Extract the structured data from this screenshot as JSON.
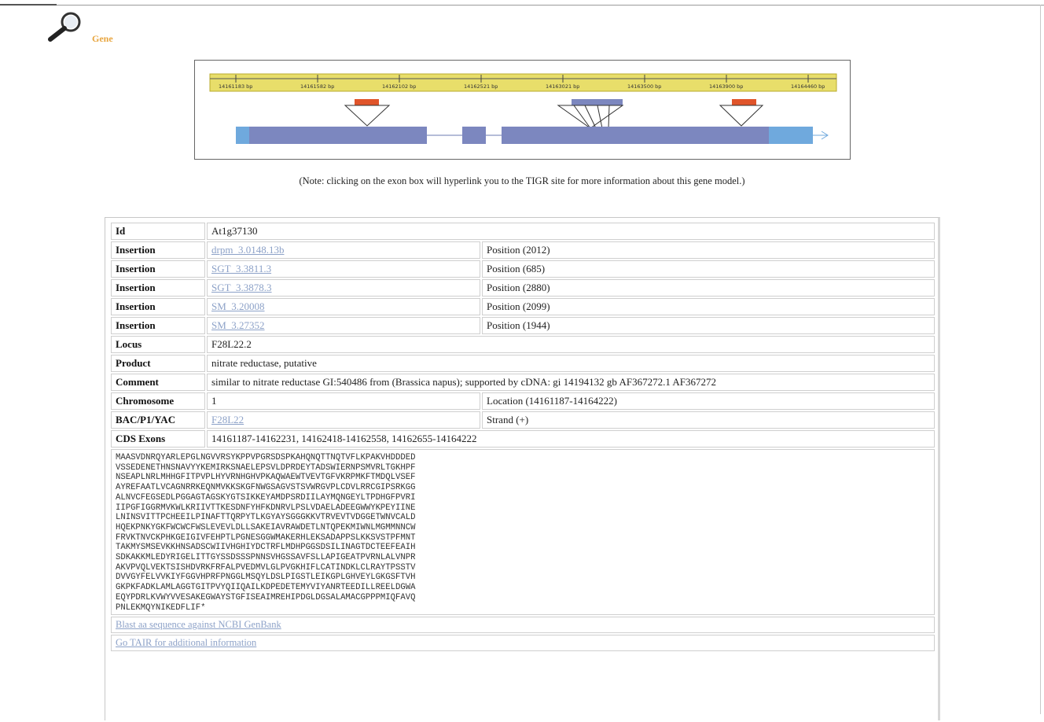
{
  "page": {
    "title": "Gene",
    "accent": "#e8a640"
  },
  "gene_model": {
    "ruler_labels": [
      "14161183 bp",
      "14161582 bp",
      "14162102 bp",
      "14162521 bp",
      "14163021 bp",
      "14163500 bp",
      "14163900 bp",
      "14164460 bp"
    ],
    "track_color": "#e8de6a",
    "exon_color": "#7c87bf",
    "utr_color": "#6fa9dd",
    "insertion_color": "#e0542a"
  },
  "note": "(Note: clicking on the exon box will hyperlink you to the TIGR site for more information about this gene model.)",
  "info": {
    "id_label": "Id",
    "id_value": "At1g37130",
    "insertions": [
      {
        "label": "Insertion",
        "link": "drpm_3.0148.13b",
        "position": "Position (2012)"
      },
      {
        "label": "Insertion",
        "link": "SGT_3.3811.3",
        "position": "Position (685)"
      },
      {
        "label": "Insertion",
        "link": "SGT_3.3878.3",
        "position": "Position (2880)"
      },
      {
        "label": "Insertion",
        "link": "SM_3.20008",
        "position": "Position (2099)"
      },
      {
        "label": "Insertion",
        "link": "SM_3.27352",
        "position": "Position (1944)"
      }
    ],
    "locus_label": "Locus",
    "locus_value": "F28L22.2",
    "product_label": "Product",
    "product_value": "nitrate reductase, putative",
    "comment_label": "Comment",
    "comment_value": "similar to nitrate reductase GI:540486 from (Brassica napus); supported by cDNA: gi 14194132 gb AF367272.1 AF367272",
    "chromosome_label": "Chromosome",
    "chromosome_value": "1",
    "location": "Location (14161187-14164222)",
    "bac_label": "BAC/P1/YAC",
    "bac_link": "F28L22",
    "strand": "Strand (+)",
    "cds_label": "CDS Exons",
    "cds_value": "14161187-14162231, 14162418-14162558, 14162655-14164222",
    "sequence": "MAASVDNRQYARLEPGLNGVVRSYKPPVPGRSDSPKAHQNQTTNQTVFLKPAKVHDDDED\nVSSEDENETHNSNAVYYKEMIRKSNAELEPSVLDPRDEYTADSWIERNPSMVRLTGKHPF\nNSEAPLNRLMHHGFITPVPLHYVRNHGHVPKAQWAEWTVEVTGFVKRPMKFTMDQLVSEF\nAYREFAATLVCAGNRRKEQNMVKKSKGFNWGSAGVSTSVWRGVPLCDVLRRCGIPSRKGG\nALNVCFEGSEDLPGGAGTAGSKYGTSIKKEYAMDPSRDIILAYMQNGEYLTPDHGFPVRI\nIIPGFIGGRMVKWLKRIIVTTKESDNFYHFKDNRVLPSLVDAELADEEGWWYKPEYIINE\nLNINSVITTPCHEEILPINAFTTQRPYTLKGYAYSGGGKKVTRVEVTVDGGETWNVCALD\nHQEKPNKYGKFWCWCFWSLEVEVLDLLSAKEIAVRAWDETLNTQPEKMIWNLMGMMNNCW\nFRVKTNVCKPHKGEIGIVFEHPTLPGNESGGWMAKERHLEKSADAPPSLKKSVSTPFMNT\nTAKMYSMSEVKKHNSADSCWIIVHGHIYDCTRFLMDHPGGSDSILINAGTDCTEEFEAIH\nSDKAKKMLEDYRIGELITTGYSSDSSSPNNSVHGSSAVFSLLAPIGEATPVRNLALVNPR\nAKVPVQLVEKTSISHDVRKFRFALPVEDMVLGLPVGKHIFLCATINDKLCLRAYTPSSTV\nDVVGYFELVVKIYFGGVHPRFPNGGLMSQYLDSLPIGSTLEIKGPLGHVEYLGKGSFTVH\nGKPKFADKLAMLAGGTGITPVYQIIQAILKDPEDETEMYVIYANRTEEDILLREELDGWA\nEQYPDRLKVWYVVESAKEGWAYSTGFISEAIMREHIPDGLDGSALAMACGPPPMIQFAVQ\nPNLEKMQYNIKEDFLIF*",
    "blast_link": "Blast aa sequence against NCBI GenBank",
    "tair_link": "Go TAIR for additional information"
  }
}
